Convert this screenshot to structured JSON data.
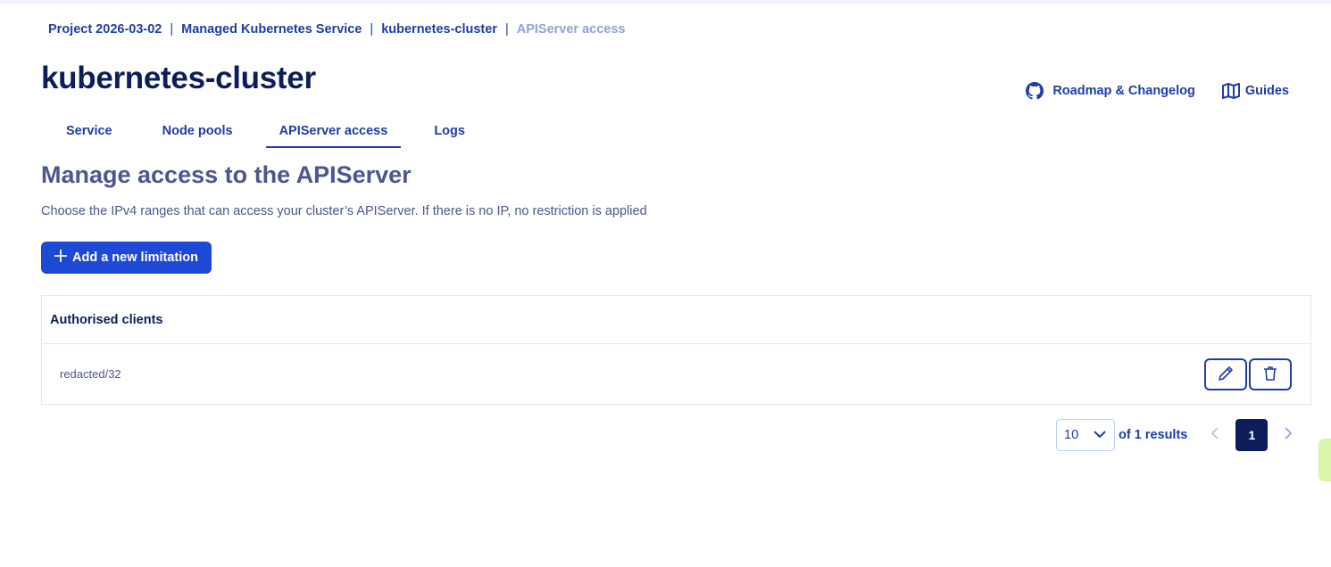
{
  "breadcrumb": {
    "project": "Project 2026-03-02",
    "service": "Managed Kubernetes Service",
    "cluster": "kubernetes-cluster",
    "current": "APIServer access",
    "separator": "|"
  },
  "page": {
    "title": "kubernetes-cluster"
  },
  "header_links": {
    "roadmap": "Roadmap & Changelog",
    "guides": "Guides"
  },
  "tabs": [
    {
      "label": "Service"
    },
    {
      "label": "Node pools"
    },
    {
      "label": "APIServer access",
      "active": true
    },
    {
      "label": "Logs"
    }
  ],
  "section": {
    "title": "Manage access to the APIServer",
    "description": "Choose the IPv4 ranges that can access your cluster’s APIServer. If there is no IP, no restriction is applied"
  },
  "add_button": {
    "label": "Add a new limitation"
  },
  "table": {
    "header": "Authorised clients",
    "rows": [
      {
        "value": "redacted/32"
      }
    ]
  },
  "pagination": {
    "page_size": "10",
    "results": "of 1 results",
    "current_page": "1"
  },
  "colors": {
    "primary": "#1e48d6",
    "link": "#1c3ea8",
    "dark": "#0b1d5a",
    "muted": "#4d5592"
  },
  "icons": [
    "github-icon",
    "map-icon",
    "plus-icon",
    "pencil-icon",
    "trash-icon",
    "chevron-down-icon",
    "chevron-left-icon",
    "chevron-right-icon"
  ]
}
